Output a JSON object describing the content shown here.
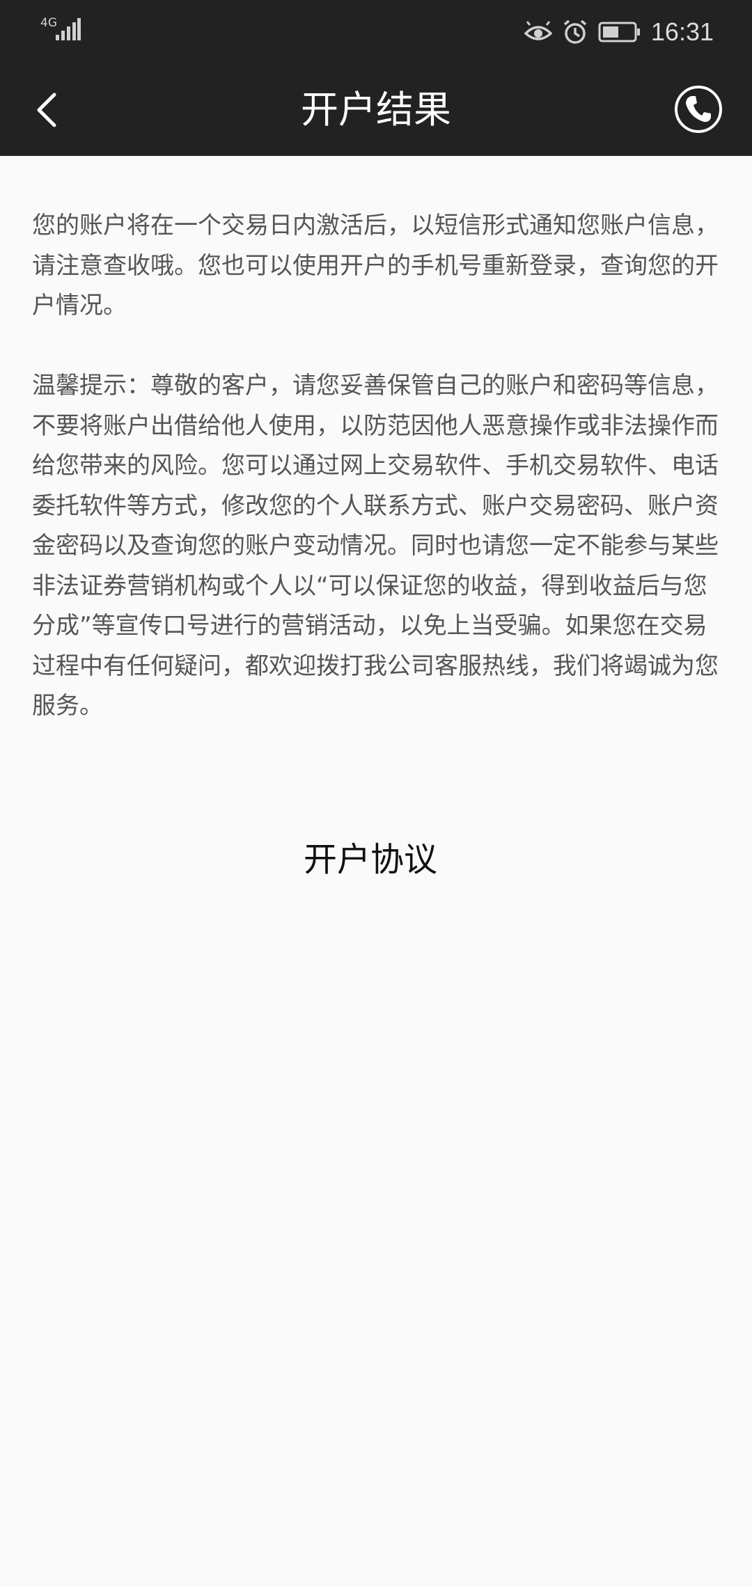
{
  "status_bar": {
    "network": "4G",
    "time": "16:31"
  },
  "header": {
    "title": "开户结果"
  },
  "content": {
    "paragraph1": "您的账户将在一个交易日内激活后，以短信形式通知您账户信息，请注意查收哦。您也可以使用开户的手机号重新登录，查询您的开户情况。",
    "paragraph2": "温馨提示：尊敬的客户，请您妥善保管自己的账户和密码等信息，不要将账户出借给他人使用，以防范因他人恶意操作或非法操作而给您带来的风险。您可以通过网上交易软件、手机交易软件、电话委托软件等方式，修改您的个人联系方式、账户交易密码、账户资金密码以及查询您的账户变动情况。同时也请您一定不能参与某些非法证券营销机构或个人以“可以保证您的收益，得到收益后与您分成”等宣传口号进行的营销活动，以免上当受骗。如果您在交易过程中有任何疑问，都欢迎拨打我公司客服热线，我们将竭诚为您服务。"
  },
  "agreement": {
    "label": "开户协议"
  },
  "icons": {
    "back": "chevron-left-icon",
    "phone": "phone-icon",
    "eye": "eye-icon",
    "alarm": "alarm-icon",
    "battery": "battery-icon",
    "signal": "signal-icon"
  },
  "colors": {
    "header_bg": "#222222",
    "page_bg": "#fafafa",
    "body_text": "#555555",
    "title_text": "#ffffff"
  }
}
